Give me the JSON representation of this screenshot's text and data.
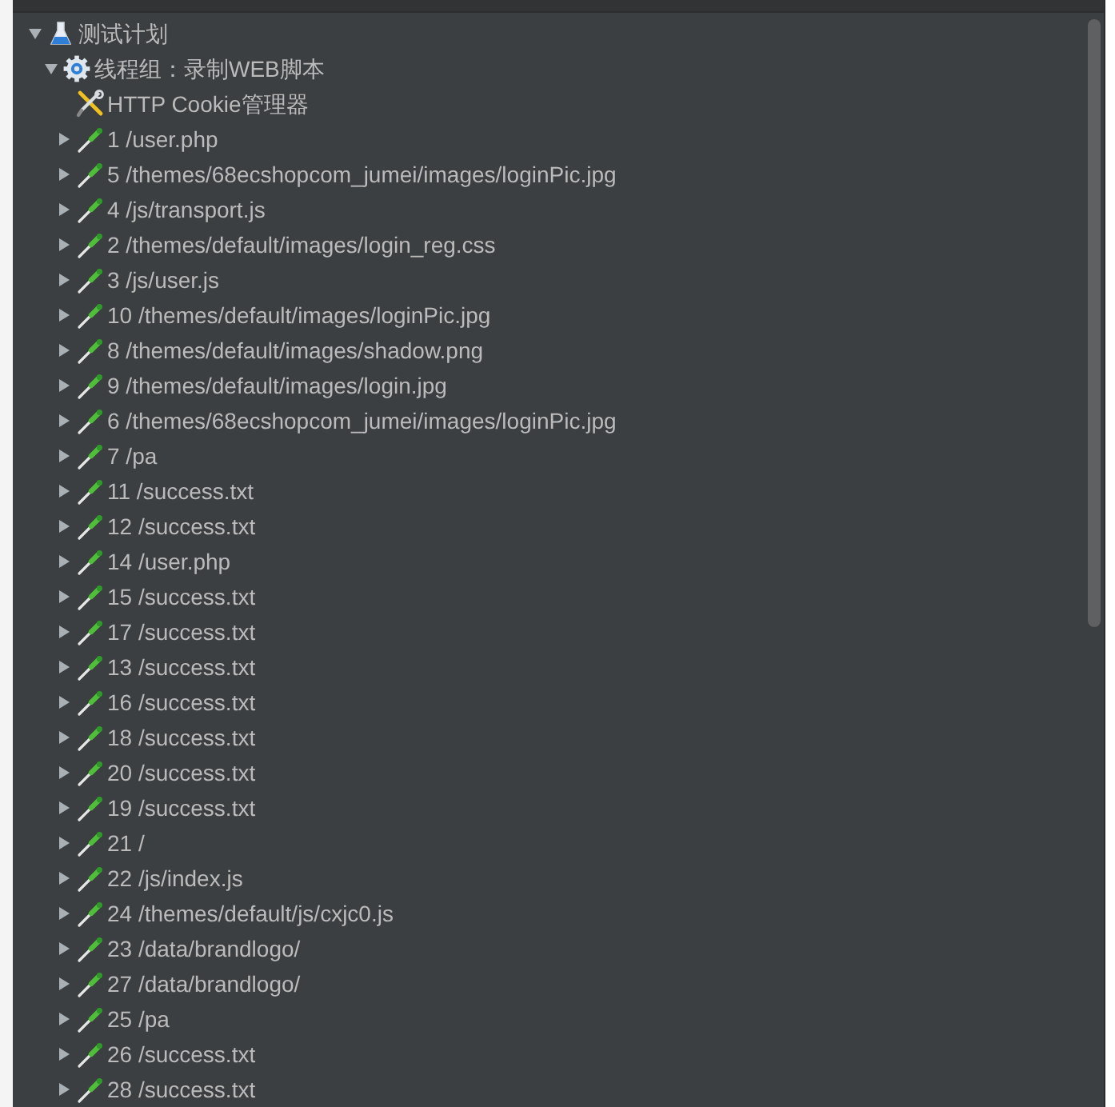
{
  "tree": [
    {
      "kind": "plan",
      "label": "测试计划",
      "expanded": true,
      "children": [
        {
          "kind": "thread_group",
          "label": "线程组：录制WEB脚本",
          "expanded": true,
          "children": [
            {
              "kind": "config",
              "label": "HTTP Cookie管理器"
            },
            {
              "kind": "sampler",
              "label": "1 /user.php",
              "expanded": false
            },
            {
              "kind": "sampler",
              "label": "5 /themes/68ecshopcom_jumei/images/loginPic.jpg",
              "expanded": false
            },
            {
              "kind": "sampler",
              "label": "4 /js/transport.js",
              "expanded": false
            },
            {
              "kind": "sampler",
              "label": "2 /themes/default/images/login_reg.css",
              "expanded": false
            },
            {
              "kind": "sampler",
              "label": "3 /js/user.js",
              "expanded": false
            },
            {
              "kind": "sampler",
              "label": "10 /themes/default/images/loginPic.jpg",
              "expanded": false
            },
            {
              "kind": "sampler",
              "label": "8 /themes/default/images/shadow.png",
              "expanded": false
            },
            {
              "kind": "sampler",
              "label": "9 /themes/default/images/login.jpg",
              "expanded": false
            },
            {
              "kind": "sampler",
              "label": "6 /themes/68ecshopcom_jumei/images/loginPic.jpg",
              "expanded": false
            },
            {
              "kind": "sampler",
              "label": "7 /pa",
              "expanded": false
            },
            {
              "kind": "sampler",
              "label": "11 /success.txt",
              "expanded": false
            },
            {
              "kind": "sampler",
              "label": "12 /success.txt",
              "expanded": false
            },
            {
              "kind": "sampler",
              "label": "14 /user.php",
              "expanded": false
            },
            {
              "kind": "sampler",
              "label": "15 /success.txt",
              "expanded": false
            },
            {
              "kind": "sampler",
              "label": "17 /success.txt",
              "expanded": false
            },
            {
              "kind": "sampler",
              "label": "13 /success.txt",
              "expanded": false
            },
            {
              "kind": "sampler",
              "label": "16 /success.txt",
              "expanded": false
            },
            {
              "kind": "sampler",
              "label": "18 /success.txt",
              "expanded": false
            },
            {
              "kind": "sampler",
              "label": "20 /success.txt",
              "expanded": false
            },
            {
              "kind": "sampler",
              "label": "19 /success.txt",
              "expanded": false
            },
            {
              "kind": "sampler",
              "label": "21 /",
              "expanded": false
            },
            {
              "kind": "sampler",
              "label": "22 /js/index.js",
              "expanded": false
            },
            {
              "kind": "sampler",
              "label": "24 /themes/default/js/cxjc0.js",
              "expanded": false
            },
            {
              "kind": "sampler",
              "label": "23 /data/brandlogo/",
              "expanded": false
            },
            {
              "kind": "sampler",
              "label": "27 /data/brandlogo/",
              "expanded": false
            },
            {
              "kind": "sampler",
              "label": "25 /pa",
              "expanded": false
            },
            {
              "kind": "sampler",
              "label": "26 /success.txt",
              "expanded": false
            },
            {
              "kind": "sampler",
              "label": "28 /success.txt",
              "expanded": false
            }
          ]
        }
      ]
    }
  ]
}
